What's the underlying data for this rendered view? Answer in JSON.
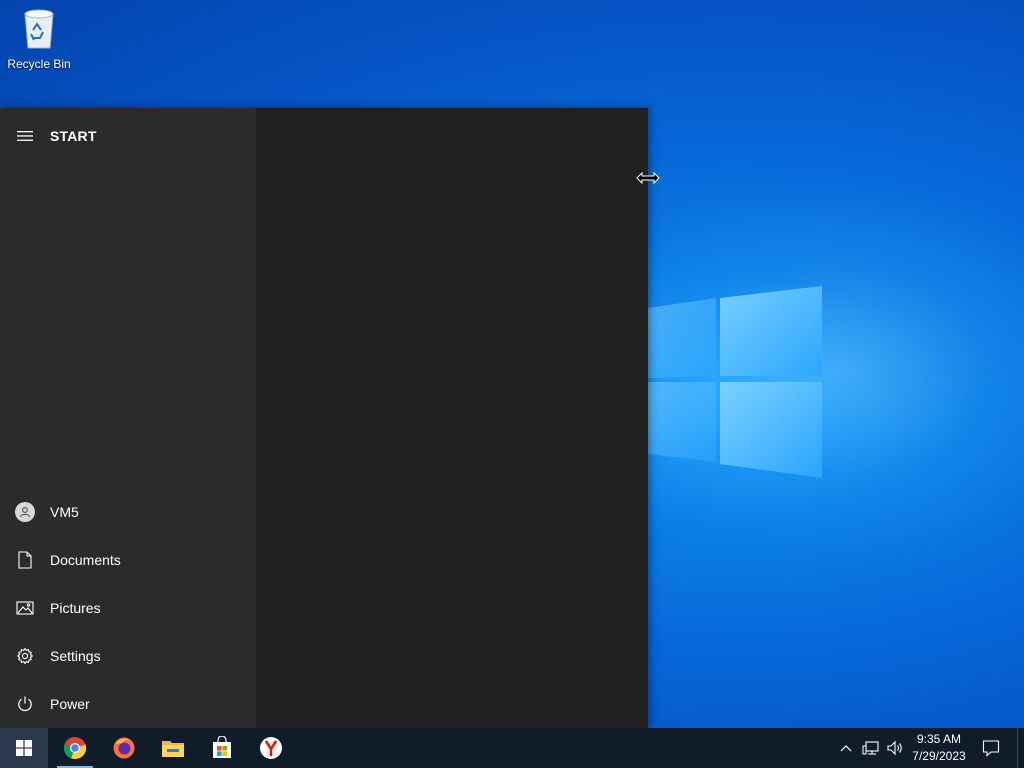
{
  "desktop": {
    "icons": [
      {
        "label": "Recycle Bin",
        "icon": "recycle-bin-icon"
      }
    ]
  },
  "start_menu": {
    "title": "START",
    "user": {
      "label": "VM5",
      "icon": "user-avatar-icon"
    },
    "items": [
      {
        "label": "Documents",
        "icon": "document-icon"
      },
      {
        "label": "Pictures",
        "icon": "pictures-icon"
      },
      {
        "label": "Settings",
        "icon": "gear-icon"
      },
      {
        "label": "Power",
        "icon": "power-icon"
      }
    ]
  },
  "taskbar": {
    "pinned": [
      {
        "name": "Google Chrome",
        "icon": "chrome-icon",
        "active": true
      },
      {
        "name": "Firefox",
        "icon": "firefox-icon",
        "active": false
      },
      {
        "name": "File Explorer",
        "icon": "file-explorer-icon",
        "active": false
      },
      {
        "name": "Microsoft Store",
        "icon": "store-icon",
        "active": false
      },
      {
        "name": "Yandex Browser",
        "icon": "yandex-icon",
        "active": false
      }
    ],
    "clock": {
      "time": "9:35 AM",
      "date": "7/29/2023"
    }
  },
  "colors": {
    "desktop_blue": "#0667d8",
    "menu_rail": "#2b2b2b",
    "menu_tiles": "#202020",
    "taskbar": "#101c2a",
    "accent": "#76b9ed"
  }
}
